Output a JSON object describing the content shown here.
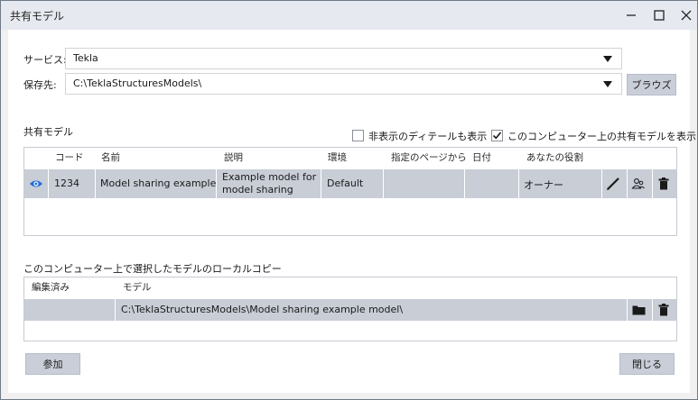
{
  "window": {
    "title": "共有モデル",
    "minimize_icon": "minimize-icon",
    "maximize_icon": "maximize-icon",
    "close_icon": "close-icon"
  },
  "service": {
    "label": "サービス:",
    "value": "Tekla"
  },
  "save_location": {
    "label": "保存先:",
    "value": "C:\\TeklaStructuresModels\\",
    "browse_label": "ブラウズ"
  },
  "shared_models": {
    "section_label": "共有モデル",
    "show_hidden_label": "非表示のディテールも表示",
    "show_hidden_checked": false,
    "show_local_label": "このコンピューター上の共有モデルを表示",
    "show_local_checked": true,
    "columns": [
      "コード",
      "名前",
      "説明",
      "環境",
      "指定のページから",
      "日付",
      "あなたの役割"
    ],
    "rows": [
      {
        "code": "1234",
        "name": "Model sharing example",
        "description": "Example model for model sharing",
        "environment": "Default",
        "from_page": "",
        "date": "",
        "role": "オーナー"
      }
    ]
  },
  "local_copies": {
    "section_label": "このコンピューター上で選択したモデルのローカルコピー",
    "columns": [
      "編集済み",
      "モデル"
    ],
    "rows": [
      {
        "edited": "",
        "model": "C:\\TeklaStructuresModels\\Model sharing example model\\"
      }
    ]
  },
  "footer": {
    "join_label": "参加",
    "close_label": "閉じる"
  },
  "colors": {
    "selection": "#c8cdd6",
    "button": "#c9ced8",
    "titlebar": "#e6e9ef"
  }
}
